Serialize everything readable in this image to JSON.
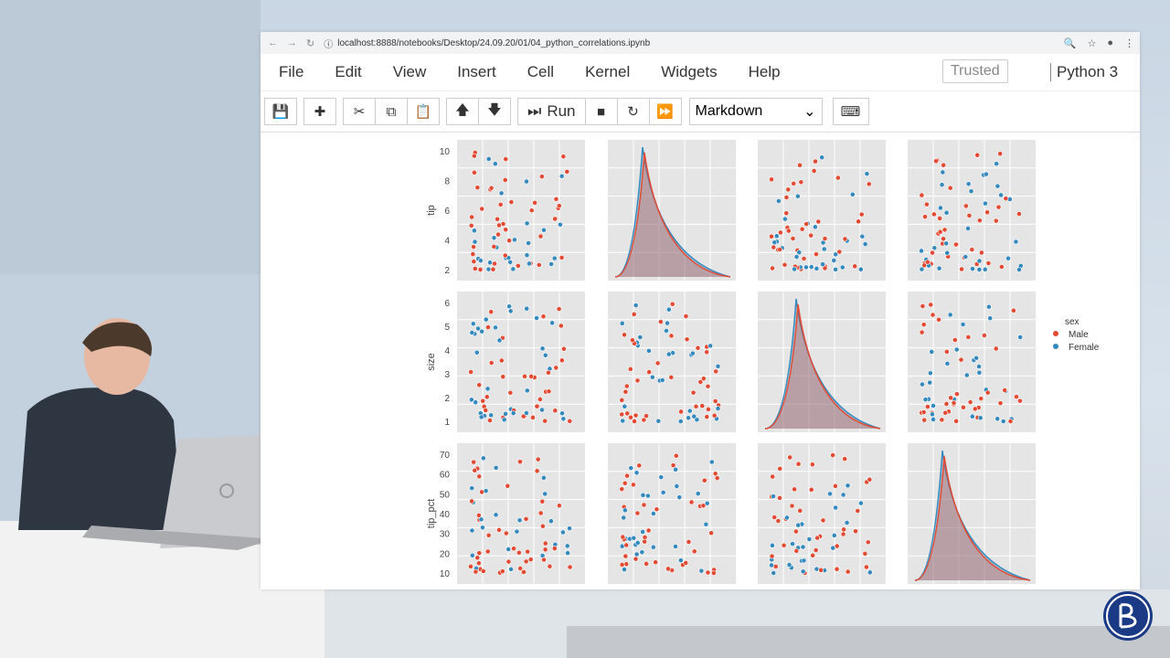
{
  "browser": {
    "url": "localhost:8888/notebooks/Desktop/24.09.20/01/04_python_correlations.ipynb"
  },
  "menu": {
    "items": [
      "File",
      "Edit",
      "View",
      "Insert",
      "Cell",
      "Kernel",
      "Widgets",
      "Help"
    ],
    "trusted": "Trusted",
    "kernel": "Python 3"
  },
  "toolbar": {
    "run_label": "Run",
    "cell_type": "Markdown"
  },
  "chart_data": {
    "type": "scatter",
    "legend": {
      "title": "sex",
      "entries": [
        "Male",
        "Female"
      ],
      "colors": [
        "#e24a33",
        "#348abd"
      ],
      "placement": "right"
    },
    "row_labels": [
      "tip",
      "size",
      "tip_pct"
    ],
    "rows": [
      {
        "label": "tip",
        "ticks": [
          "2",
          "4",
          "6",
          "8",
          "10"
        ],
        "ylim": [
          1,
          10
        ]
      },
      {
        "label": "size",
        "ticks": [
          "1",
          "2",
          "3",
          "4",
          "5",
          "6"
        ],
        "ylim": [
          1,
          6
        ]
      },
      {
        "label": "tip_pct",
        "ticks": [
          "10",
          "20",
          "30",
          "40",
          "50",
          "60",
          "70"
        ],
        "ylim": [
          5,
          71
        ]
      }
    ],
    "grid": true
  }
}
